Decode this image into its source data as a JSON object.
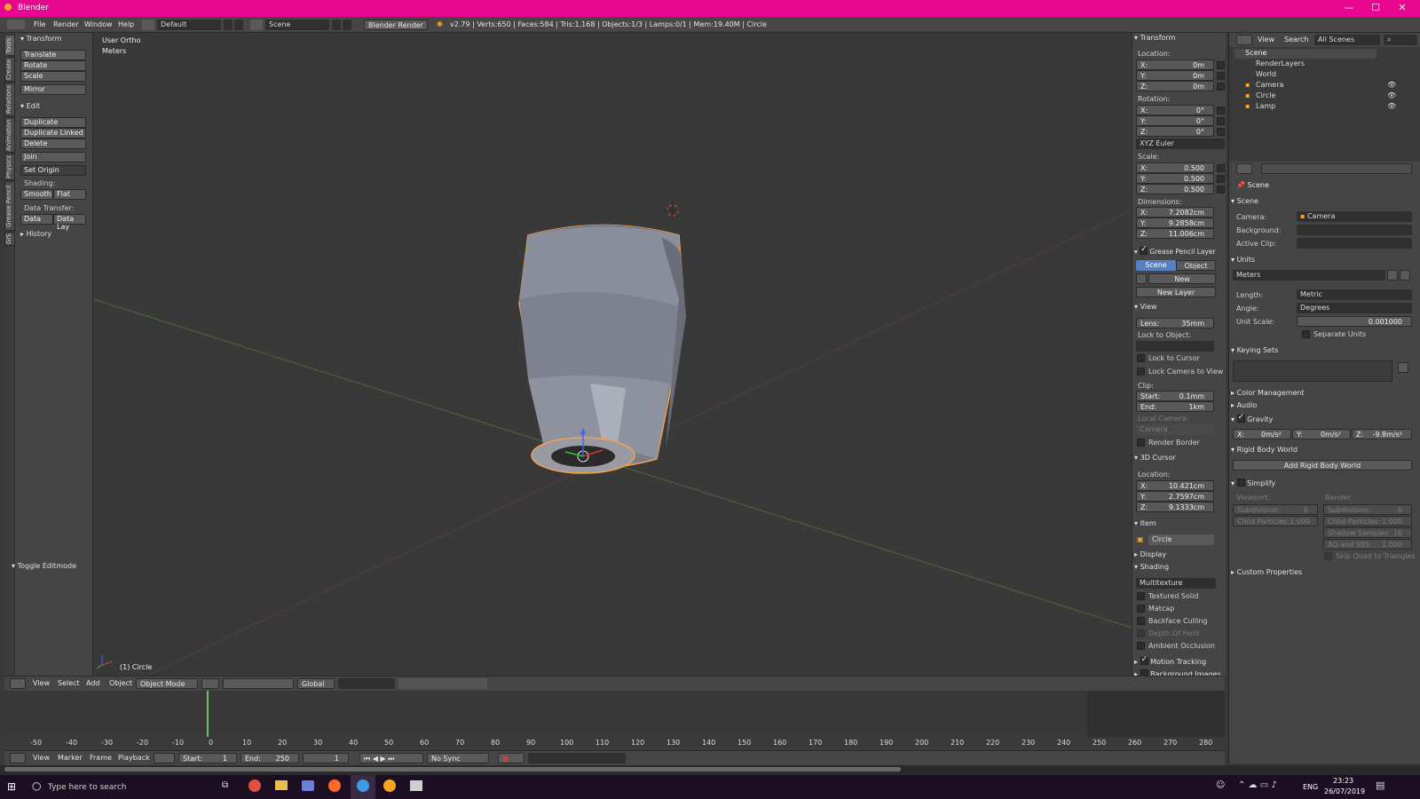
{
  "window": {
    "title": "Blender"
  },
  "menubar": {
    "items": [
      "File",
      "Render",
      "Window",
      "Help"
    ],
    "screen_layout": "Default",
    "scene": "Scene",
    "render_engine": "Blender Render",
    "stats": "v2.79 | Verts:650 | Faces:584 | Tris:1,168 | Objects:1/3 | Lamps:0/1 | Mem:19.40M | Circle"
  },
  "left_tabs": [
    "Tools",
    "Create",
    "Relations",
    "Animation",
    "Physics",
    "Grease Pencil",
    "GIS"
  ],
  "toolshelf": {
    "transform_header": "Transform",
    "transform_buttons": [
      "Translate",
      "Rotate",
      "Scale",
      "Mirror"
    ],
    "edit_header": "Edit",
    "edit_buttons": [
      "Duplicate",
      "Duplicate Linked",
      "Delete",
      "Join"
    ],
    "set_origin": "Set Origin",
    "shading_label": "Shading:",
    "shading_buttons": [
      "Smooth",
      "Flat"
    ],
    "data_transfer_label": "Data Transfer:",
    "data_transfer_buttons": [
      "Data",
      "Data Lay"
    ],
    "history_header": "History",
    "toggle_editmode": "Toggle Editmode"
  },
  "viewport": {
    "view_name": "User Ortho",
    "units": "Meters",
    "object_label": "(1) Circle"
  },
  "npanel": {
    "transform_header": "Transform",
    "location_label": "Location:",
    "location": [
      {
        "axis": "X:",
        "value": "0m"
      },
      {
        "axis": "Y:",
        "value": "0m"
      },
      {
        "axis": "Z:",
        "value": "0m"
      }
    ],
    "rotation_label": "Rotation:",
    "rotation": [
      {
        "axis": "X:",
        "value": "0°"
      },
      {
        "axis": "Y:",
        "value": "0°"
      },
      {
        "axis": "Z:",
        "value": "0°"
      }
    ],
    "rotation_mode": "XYZ Euler",
    "scale_label": "Scale:",
    "scale": [
      {
        "axis": "X:",
        "value": "0.500"
      },
      {
        "axis": "Y:",
        "value": "0.500"
      },
      {
        "axis": "Z:",
        "value": "0.500"
      }
    ],
    "dimensions_label": "Dimensions:",
    "dimensions": [
      {
        "axis": "X:",
        "value": "7.2082cm"
      },
      {
        "axis": "Y:",
        "value": "9.2858cm"
      },
      {
        "axis": "Z:",
        "value": "11.006cm"
      }
    ],
    "grease_header": "Grease Pencil Layer",
    "grease_tab_scene": "Scene",
    "grease_tab_object": "Object",
    "grease_new": "New",
    "grease_new_layer": "New Layer",
    "view_header": "View",
    "lens": "Lens:",
    "lens_value": "35mm",
    "lock_to_object": "Lock to Object:",
    "lock_to_cursor": "Lock to Cursor",
    "lock_camera": "Lock Camera to View",
    "clip_label": "Clip:",
    "clip_start_label": "Start:",
    "clip_start": "0.1mm",
    "clip_end_label": "End:",
    "clip_end": "1km",
    "local_camera": "Local Camera:",
    "local_camera_value": "Camera",
    "render_border": "Render Border",
    "cursor_header": "3D Cursor",
    "cursor_location_label": "Location:",
    "cursor": [
      {
        "axis": "X:",
        "value": "10.421cm"
      },
      {
        "axis": "Y:",
        "value": "2.7597cm"
      },
      {
        "axis": "Z:",
        "value": "9.1333cm"
      }
    ],
    "item_header": "Item",
    "item_name": "Circle",
    "display_header": "Display",
    "shading_header": "Shading",
    "shading_mode": "Multitexture",
    "shading_options": [
      "Textured Solid",
      "Matcap",
      "Backface Culling",
      "Depth Of Field",
      "Ambient Occlusion"
    ],
    "motion_tracking": "Motion Tracking",
    "background_images": "Background Images"
  },
  "outliner": {
    "menu": [
      "View",
      "Search"
    ],
    "filter": "All Scenes",
    "tree": [
      {
        "name": "Scene",
        "indent": 0
      },
      {
        "name": "RenderLayers",
        "indent": 1
      },
      {
        "name": "World",
        "indent": 1
      },
      {
        "name": "Camera",
        "indent": 1
      },
      {
        "name": "Circle",
        "indent": 1
      },
      {
        "name": "Lamp",
        "indent": 1
      }
    ]
  },
  "properties": {
    "breadcrumb": "Scene",
    "scene_header": "Scene",
    "camera_label": "Camera:",
    "camera_value": "Camera",
    "background_label": "Background:",
    "active_clip_label": "Active Clip:",
    "units_header": "Units",
    "units_preset": "Meters",
    "length_label": "Length:",
    "length_value": "Metric",
    "angle_label": "Angle:",
    "angle_value": "Degrees",
    "unit_scale_label": "Unit Scale:",
    "unit_scale_value": "0.001000",
    "separate_units": "Separate Units",
    "keying_sets_header": "Keying Sets",
    "color_management_header": "Color Management",
    "audio_header": "Audio",
    "gravity_header": "Gravity",
    "gravity": [
      {
        "axis": "X:",
        "value": "0m/s²"
      },
      {
        "axis": "Y:",
        "value": "0m/s²"
      },
      {
        "axis": "Z:",
        "value": "-9.8m/s²"
      }
    ],
    "rigid_body_header": "Rigid Body World",
    "add_rigid_body": "Add Rigid Body World",
    "simplify_header": "Simplify",
    "viewport_label": "Viewport:",
    "render_label": "Render:",
    "simplify_viewport": [
      {
        "label": "Subdivision:",
        "value": "6"
      },
      {
        "label": "Child Particles:",
        "value": "1.000"
      }
    ],
    "simplify_render": [
      {
        "label": "Subdivision:",
        "value": "6"
      },
      {
        "label": "Child Particles:",
        "value": "1.000"
      },
      {
        "label": "Shadow Samples:",
        "value": "16"
      },
      {
        "label": "AO and SSS:",
        "value": "1.000"
      }
    ],
    "skip_quad": "Skip Quad to Triangles",
    "custom_props_header": "Custom Properties"
  },
  "viewport_header": {
    "menu": [
      "View",
      "Select",
      "Add",
      "Object"
    ],
    "mode": "Object Mode",
    "orientation": "Global"
  },
  "timeline": {
    "ticks": [
      "-50",
      "-40",
      "-30",
      "-20",
      "-10",
      "0",
      "10",
      "20",
      "30",
      "40",
      "50",
      "60",
      "70",
      "80",
      "90",
      "100",
      "110",
      "120",
      "130",
      "140",
      "150",
      "160",
      "170",
      "180",
      "190",
      "200",
      "210",
      "220",
      "230",
      "240",
      "250",
      "260",
      "270",
      "280"
    ],
    "menu": [
      "View",
      "Marker",
      "Frame",
      "Playback"
    ],
    "start_label": "Start:",
    "start": "1",
    "end_label": "End:",
    "end": "250",
    "current": "1",
    "sync": "No Sync"
  },
  "taskbar": {
    "search_placeholder": "Type here to search",
    "language": "ENG",
    "time": "23:23",
    "date": "26/07/2019"
  },
  "colors": {
    "titlebar": "#e8068e",
    "accent": "#5680c2",
    "object_outline": "#f0a050"
  }
}
